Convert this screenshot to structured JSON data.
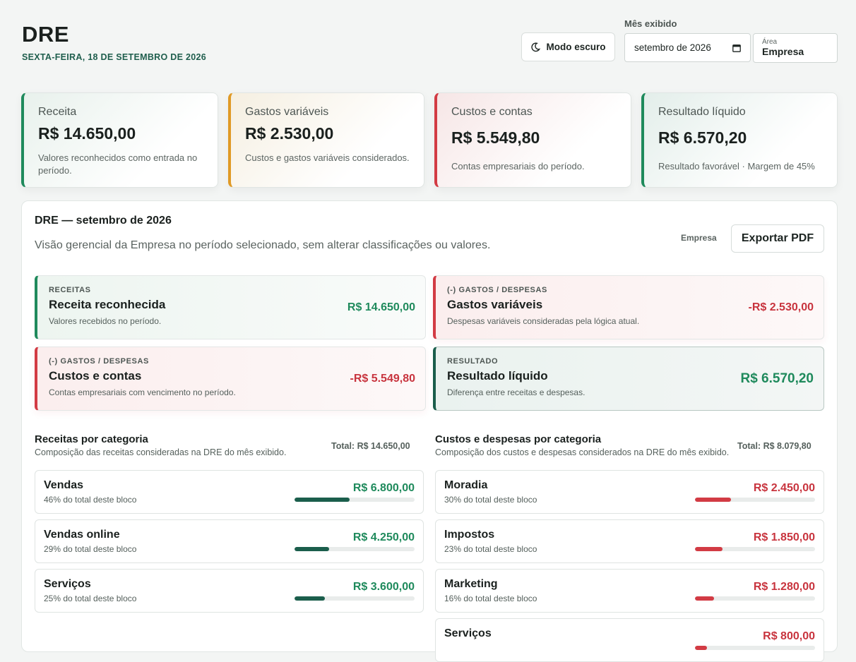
{
  "header": {
    "title": "DRE",
    "date": "SEXTA-FEIRA, 18 DE SETEMBRO DE 2026",
    "dark_mode_label": "Modo escuro",
    "month_label": "Mês exibido",
    "month_value": "setembro de 2026",
    "area_label": "Área",
    "area_value": "Empresa"
  },
  "summary": [
    {
      "name": "Receita",
      "amount": "R$ 14.650,00",
      "desc": "Valores reconhecidos como entrada no período."
    },
    {
      "name": "Gastos variáveis",
      "amount": "R$ 2.530,00",
      "desc": "Custos e gastos variáveis considerados."
    },
    {
      "name": "Custos e contas",
      "amount": "R$ 5.549,80",
      "desc": "Contas empresariais do período."
    },
    {
      "name": "Resultado líquido",
      "amount": "R$ 6.570,20",
      "desc": "Resultado favorável · Margem de 45%"
    }
  ],
  "panel": {
    "title": "DRE — setembro de 2026",
    "subtitle": "Visão gerencial da Empresa no período selecionado, sem alterar classificações ou valores.",
    "area": "Empresa",
    "export_label": "Exportar PDF"
  },
  "dre_lines": [
    {
      "tag": "RECEITAS",
      "head": "Receita reconhecida",
      "note": "Valores recebidos no período.",
      "value": "R$ 14.650,00"
    },
    {
      "tag": "(-) GASTOS / DESPESAS",
      "head": "Gastos variáveis",
      "note": "Despesas variáveis consideradas pela lógica atual.",
      "value": "-R$ 2.530,00"
    },
    {
      "tag": "(-) GASTOS / DESPESAS",
      "head": "Custos e contas",
      "note": "Contas empresariais com vencimento no período.",
      "value": "-R$ 5.549,80"
    },
    {
      "tag": "RESULTADO",
      "head": "Resultado líquido",
      "note": "Diferença entre receitas e despesas.",
      "value": "R$ 6.570,20"
    }
  ],
  "revenue_block": {
    "title": "Receitas por categoria",
    "subtitle": "Composição das receitas consideradas na DRE do mês exibido.",
    "total": "Total: R$ 14.650,00",
    "items": [
      {
        "name": "Vendas",
        "pct_text": "46% do total deste bloco",
        "value": "R$ 6.800,00",
        "share": 0.46
      },
      {
        "name": "Vendas online",
        "pct_text": "29% do total deste bloco",
        "value": "R$ 4.250,00",
        "share": 0.29
      },
      {
        "name": "Serviços",
        "pct_text": "25% do total deste bloco",
        "value": "R$ 3.600,00",
        "share": 0.25
      }
    ]
  },
  "expense_block": {
    "title": "Custos e despesas por categoria",
    "subtitle": "Composição dos custos e despesas considerados na DRE do mês exibido.",
    "total": "Total: R$ 8.079,80",
    "items": [
      {
        "name": "Moradia",
        "pct_text": "30% do total deste bloco",
        "value": "R$ 2.450,00",
        "share": 0.3
      },
      {
        "name": "Impostos",
        "pct_text": "23% do total deste bloco",
        "value": "R$ 1.850,00",
        "share": 0.23
      },
      {
        "name": "Marketing",
        "pct_text": "16% do total deste bloco",
        "value": "R$ 1.280,00",
        "share": 0.16
      },
      {
        "name": "Serviços",
        "pct_text": "",
        "value": "R$ 800,00",
        "share": 0.1
      }
    ]
  },
  "colors": {
    "positive": "#1f8a5c",
    "negative": "#c8343e",
    "accent_dark": "#1b5e4c",
    "warning": "#e09a26"
  },
  "icons": {
    "dark_mode": "moon-icon",
    "calendar": "calendar-icon"
  }
}
